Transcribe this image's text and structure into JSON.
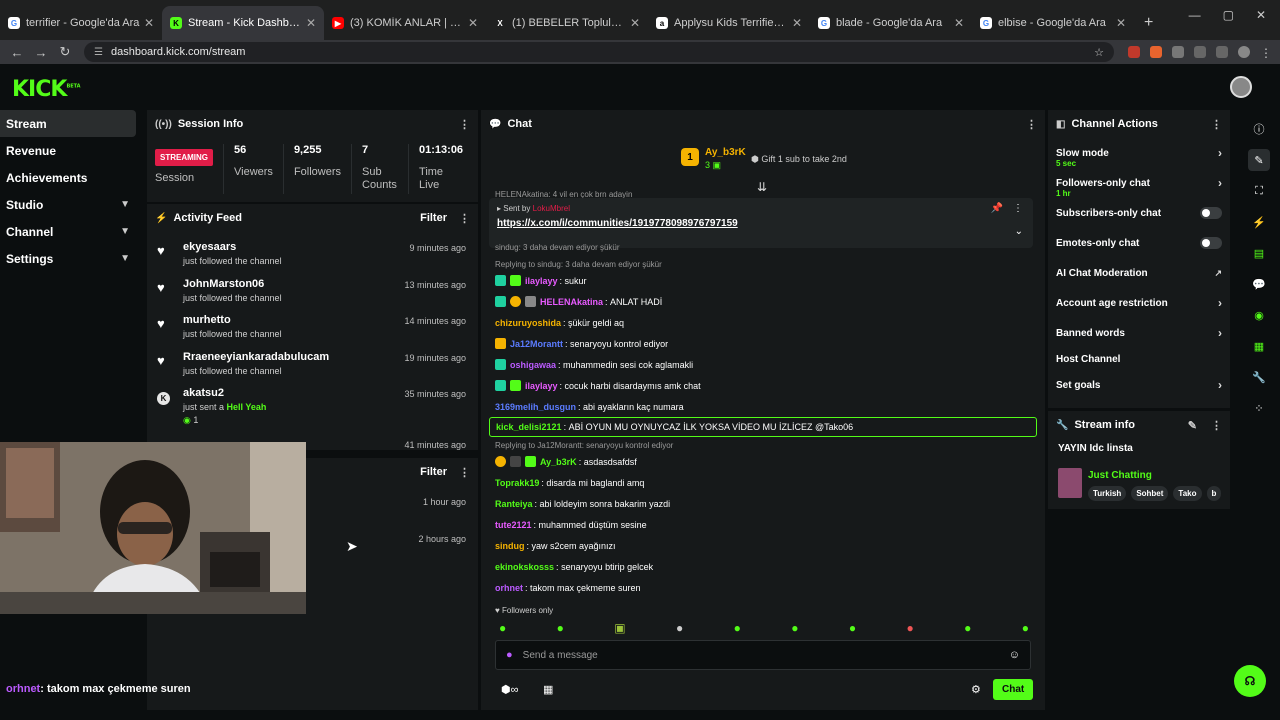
{
  "browser": {
    "tabs": [
      {
        "label": "terrifier - Google'da Ara",
        "fav": "G",
        "color": "#ffffff"
      },
      {
        "label": "Stream - Kick Dashboard",
        "fav": "K",
        "color": "#53fc18"
      },
      {
        "label": "(3) KOMİK ANLAR | TAKO | @Ja",
        "fav": "▶",
        "color": "#ff0000"
      },
      {
        "label": "(1) BEBELER Topluluk / X",
        "fav": "X",
        "color": "#ffffff"
      },
      {
        "label": "Applysu Kids Terrifier Costume",
        "fav": "a",
        "color": "#ffffff"
      },
      {
        "label": "blade - Google'da Ara",
        "fav": "G",
        "color": "#ffffff"
      },
      {
        "label": "elbise - Google'da Ara",
        "fav": "G",
        "color": "#ffffff"
      }
    ],
    "url": "dashboard.kick.com/stream"
  },
  "logo": "KICK",
  "logo_sup": "BETA",
  "sidebar": {
    "items": [
      {
        "label": "Stream"
      },
      {
        "label": "Revenue"
      },
      {
        "label": "Achievements"
      },
      {
        "label": "Studio"
      },
      {
        "label": "Channel"
      },
      {
        "label": "Settings"
      }
    ]
  },
  "session": {
    "title": "Session Info",
    "badge": "STREAMING",
    "session_label": "Session",
    "stats": [
      {
        "value": "56",
        "label": "Viewers"
      },
      {
        "value": "9,255",
        "label": "Followers"
      },
      {
        "value": "7",
        "label": "Sub Counts"
      },
      {
        "value": "01:13:06",
        "label": "Time Live"
      }
    ]
  },
  "feed": {
    "title": "Activity Feed",
    "filter": "Filter",
    "items": [
      {
        "name": "ekyesaars",
        "desc": "just followed the channel",
        "time": "9 minutes ago"
      },
      {
        "name": "JohnMarston06",
        "desc": "just followed the channel",
        "time": "13 minutes ago"
      },
      {
        "name": "murhetto",
        "desc": "just followed the channel",
        "time": "14 minutes ago"
      },
      {
        "name": "Rraeneeyiankaradabulucam",
        "desc": "just followed the channel",
        "time": "19 minutes ago"
      },
      {
        "name": "akatsu2",
        "desc": "just sent a",
        "gift": "Hell Yeah",
        "count": "1",
        "time": "35 minutes ago"
      }
    ],
    "time_6": "41 minutes ago",
    "second_filter": "Filter",
    "time_7": "1 hour ago",
    "time_8": "2 hours ago"
  },
  "chat": {
    "title": "Chat",
    "gifter": {
      "name": "Ay_b3rK",
      "count": "3",
      "note": "Gift 1 sub to take 2nd"
    },
    "pinned_sent_by": "Sent by",
    "pinned_user": "LokuMbrel",
    "pinned_link": "https://x.com/i/communities/1919778098976797159",
    "top_partial": "HELENAkatina: 4 vil en çok brn adayin",
    "partial_under": "sindug: 3 daha devam ediyor şükür",
    "messages": [
      {
        "type": "reply",
        "text": "Replying to sindug: 3 daha devam ediyor şükür"
      },
      {
        "user": "ilaylayy",
        "color": "#e85bff",
        "text": "sukur",
        "badges": [
          "#1fd1a0",
          "#53fc18"
        ]
      },
      {
        "user": "HELENAkatina",
        "color": "#e85bff",
        "text": "ANLAT HADİ",
        "badges": [
          "#1fd1a0",
          "#f5b301",
          "#888888"
        ]
      },
      {
        "user": "chizuruyoshida",
        "color": "#f5b301",
        "text": "şükür geldi aq",
        "badges": []
      },
      {
        "user": "Ja12Morantt",
        "color": "#5b7cff",
        "text": "senaryoyu kontrol ediyor",
        "badges": [
          "#f5b301"
        ]
      },
      {
        "user": "oshigawaa",
        "color": "#bb5bff",
        "text": "muhammedin sesi cok aglamakli",
        "badges": [
          "#1fd1a0"
        ]
      },
      {
        "user": "ilaylayy",
        "color": "#e85bff",
        "text": "cocuk harbi disardaymıs amk chat",
        "badges": [
          "#1fd1a0",
          "#53fc18"
        ]
      },
      {
        "user": "3169melih_dusgun",
        "color": "#5b7cff",
        "text": "abi ayakların kaç numara",
        "badges": []
      },
      {
        "user": "kick_delisi2121",
        "color": "#53fc18",
        "text": "ABİ OYUN MU OYNUYCAZ İLK YOKSA VİDEO MU İZLİCEZ @Tako06",
        "highlight": true,
        "badges": []
      },
      {
        "type": "reply",
        "text": "Replying to Ja12Morantt: senaryoyu kontrol ediyor"
      },
      {
        "user": "Ay_b3rK",
        "color": "#53fc18",
        "text": "asdasdsafdsf",
        "badges": [
          "#f5b301",
          "#444444",
          "#53fc18"
        ]
      },
      {
        "user": "Toprakk19",
        "color": "#53fc18",
        "text": "disarda mi baglandi amq",
        "badges": []
      },
      {
        "user": "Ranteiya",
        "color": "#53fc18",
        "text": "abi loldeyim sonra bakarim yazdi",
        "badges": []
      },
      {
        "user": "tute2121",
        "color": "#e85bff",
        "text": "muhammed düştüm sesine",
        "badges": []
      },
      {
        "user": "sindug",
        "color": "#f5b301",
        "text": "yaw s2cem ayağınızı",
        "badges": []
      },
      {
        "user": "ekinokskosss",
        "color": "#53fc18",
        "text": "senaryoyu btirip gelcek",
        "badges": []
      },
      {
        "user": "orhnet",
        "color": "#bb5bff",
        "text": "takom max çekmeme suren",
        "badges": []
      }
    ],
    "followers_only": "Followers only",
    "placeholder": "Send a message",
    "send_label": "Chat"
  },
  "channel_actions": {
    "title": "Channel Actions",
    "rows": [
      {
        "label": "Slow mode",
        "sub": "5 sec",
        "kind": "chev"
      },
      {
        "label": "Followers-only chat",
        "sub": "1 hr",
        "kind": "chev"
      },
      {
        "label": "Subscribers-only chat",
        "kind": "toggle"
      },
      {
        "label": "Emotes-only chat",
        "kind": "toggle"
      },
      {
        "label": "AI Chat Moderation",
        "kind": "ext"
      },
      {
        "label": "Account age restriction",
        "kind": "chev"
      },
      {
        "label": "Banned words",
        "kind": "chev"
      },
      {
        "label": "Host Channel",
        "kind": "none"
      },
      {
        "label": "Set goals",
        "kind": "chev"
      }
    ]
  },
  "stream_info": {
    "title": "Stream info",
    "stream_title": "YAYIN Idc linsta",
    "category": "Just Chatting",
    "tags": [
      "Turkish",
      "Sohbet",
      "Tako",
      "b"
    ]
  },
  "overlay": {
    "user": "orhnet",
    "text": ": takom max çekmeme suren"
  }
}
